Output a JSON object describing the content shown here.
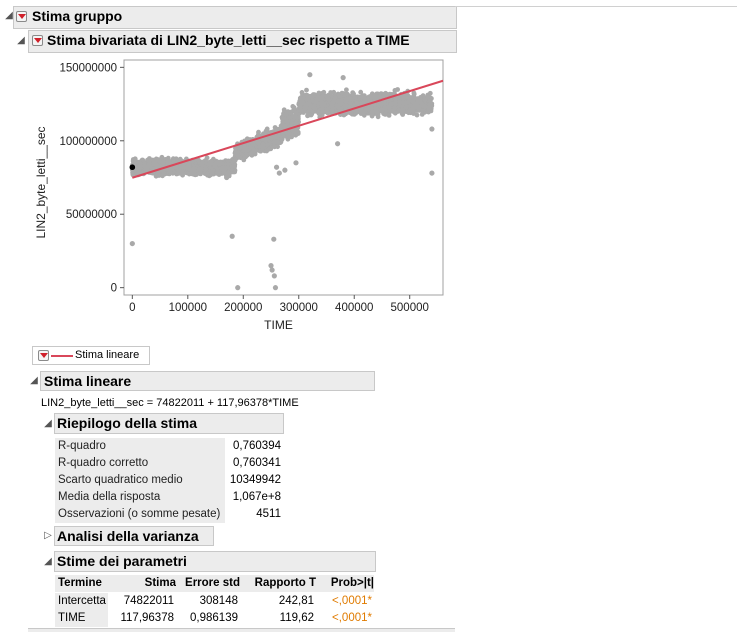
{
  "group": {
    "title": "Stima gruppo"
  },
  "bivariate": {
    "title": "Stima bivariata di LIN2_byte_letti__sec rispetto a TIME"
  },
  "chart_data": {
    "type": "scatter",
    "xlabel": "TIME",
    "ylabel": "LIN2_byte_letti__sec",
    "xlim": [
      -15000,
      560000
    ],
    "ylim": [
      -5000000,
      155000000
    ],
    "xticks": [
      "0",
      "100000",
      "200000",
      "300000",
      "400000",
      "500000"
    ],
    "xtick_values": [
      0,
      100000,
      200000,
      300000,
      400000,
      500000
    ],
    "yticks": [
      "0",
      "50000000",
      "100000000",
      "150000000"
    ],
    "ytick_values": [
      0,
      50000000,
      100000000,
      150000000
    ],
    "clusters": [
      {
        "x_range": [
          0,
          185000
        ],
        "y_center": 82000000,
        "y_spread": 5000000
      },
      {
        "x_range": [
          185000,
          270000
        ],
        "y_center": 97000000,
        "y_spread": 6000000
      },
      {
        "x_range": [
          270000,
          300000
        ],
        "y_center": 112000000,
        "y_spread": 9000000
      },
      {
        "x_range": [
          300000,
          540000
        ],
        "y_center": 125000000,
        "y_spread": 7000000
      }
    ],
    "outliers": [
      {
        "x": 0,
        "y": 30000000
      },
      {
        "x": 180000,
        "y": 35000000
      },
      {
        "x": 190000,
        "y": 0
      },
      {
        "x": 255000,
        "y": 33000000
      },
      {
        "x": 250000,
        "y": 15000000
      },
      {
        "x": 252000,
        "y": 12000000
      },
      {
        "x": 256000,
        "y": 8000000
      },
      {
        "x": 258000,
        "y": 0
      },
      {
        "x": 260000,
        "y": 82000000
      },
      {
        "x": 265000,
        "y": 78000000
      },
      {
        "x": 275000,
        "y": 80000000
      },
      {
        "x": 295000,
        "y": 85000000
      },
      {
        "x": 370000,
        "y": 98000000
      },
      {
        "x": 540000,
        "y": 78000000
      },
      {
        "x": 540000,
        "y": 108000000
      },
      {
        "x": 320000,
        "y": 145000000
      },
      {
        "x": 380000,
        "y": 143000000
      },
      {
        "x": 170000,
        "y": 75000000
      }
    ],
    "highlight_point": {
      "x": 0,
      "y": 82000000
    },
    "fit_line": {
      "intercept": 74822011,
      "slope": 117.96378,
      "color": "#d9475a"
    },
    "point_color": "#a9a9a9",
    "grid": false
  },
  "legend": {
    "label": "Stima lineare"
  },
  "linear_fit": {
    "title": "Stima lineare",
    "equation": "LIN2_byte_letti__sec = 74822011 + 117,96378*TIME"
  },
  "summary": {
    "title": "Riepilogo della stima",
    "rows": [
      {
        "label": "R-quadro",
        "value": "0,760394"
      },
      {
        "label": "R-quadro corretto",
        "value": "0,760341"
      },
      {
        "label": "Scarto quadratico medio",
        "value": "10349942"
      },
      {
        "label": "Media della risposta",
        "value": "1,067e+8"
      },
      {
        "label": "Osservazioni (o somme pesate)",
        "value": "4511"
      }
    ]
  },
  "anova": {
    "title": "Analisi della varianza"
  },
  "params": {
    "title": "Stime dei parametri",
    "headers": [
      "Termine",
      "Stima",
      "Errore std",
      "Rapporto T",
      "Prob>|t|"
    ],
    "rows": [
      [
        "Intercetta",
        "74822011",
        "308148",
        "242,81",
        "<,0001*"
      ],
      [
        "TIME",
        "117,96378",
        "0,986139",
        "119,62",
        "<,0001*"
      ]
    ]
  }
}
